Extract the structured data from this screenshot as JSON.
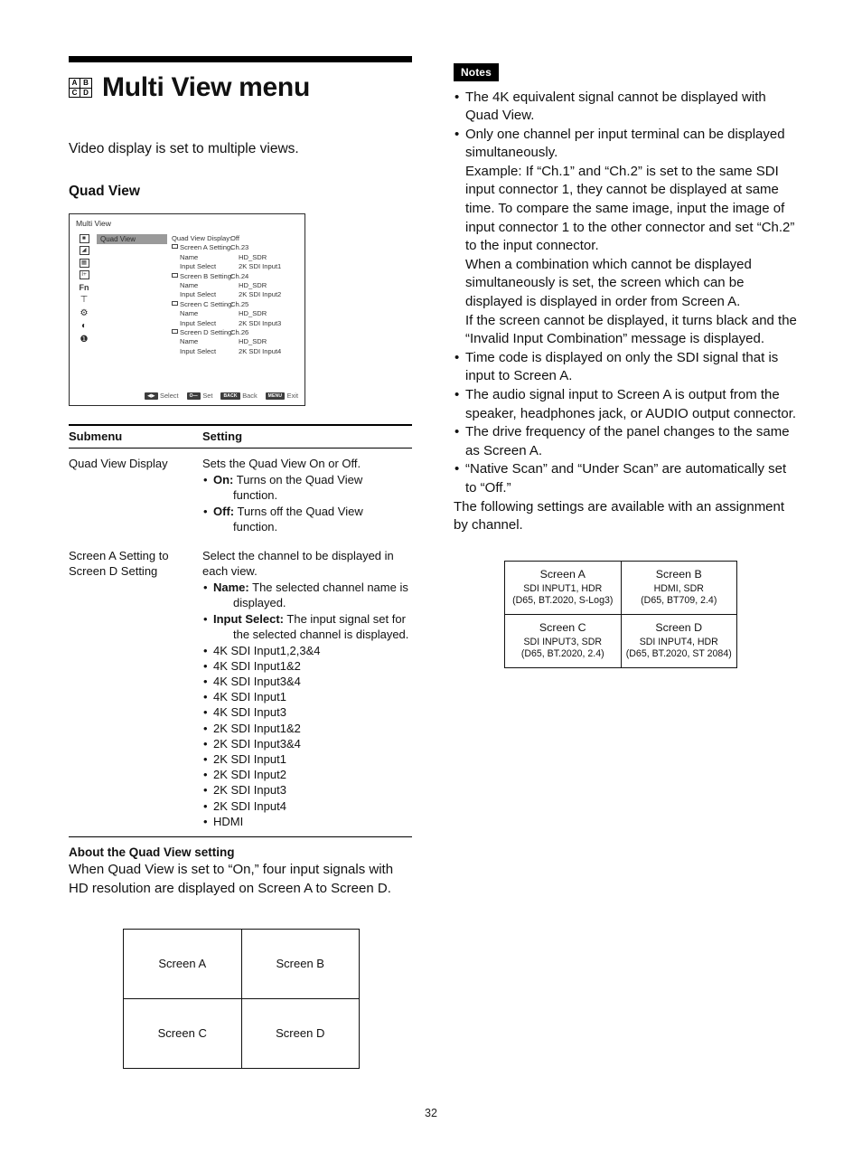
{
  "title": {
    "heading": "Multi View menu",
    "icon_cells": [
      "A",
      "B",
      "C",
      "D"
    ],
    "intro": "Video display is set to multiple views.",
    "section": "Quad View"
  },
  "osd": {
    "window_title": "Multi View",
    "sidebar_icons": [
      "1",
      "picture-icon",
      "grid-icon",
      "input-icon",
      "Fn",
      "layout-icon",
      "gear-icon",
      "contrast-icon",
      "info-icon"
    ],
    "selected_item": "Quad View",
    "rows": [
      {
        "label": "Quad View Display:",
        "value": "Off",
        "indent": false,
        "marker": false
      },
      {
        "label": "Screen A Setting:",
        "value": "Ch.23",
        "indent": false,
        "marker": true
      },
      {
        "label": "Name",
        "value": "HD_SDR",
        "indent": true,
        "marker": false
      },
      {
        "label": "Input Select",
        "value": "2K SDI Input1",
        "indent": true,
        "marker": false
      },
      {
        "label": "Screen B Setting:",
        "value": "Ch.24",
        "indent": false,
        "marker": true
      },
      {
        "label": "Name",
        "value": "HD_SDR",
        "indent": true,
        "marker": false
      },
      {
        "label": "Input Select",
        "value": "2K SDI Input2",
        "indent": true,
        "marker": false
      },
      {
        "label": "Screen C Setting:",
        "value": "Ch.25",
        "indent": false,
        "marker": true
      },
      {
        "label": "Name",
        "value": "HD_SDR",
        "indent": true,
        "marker": false
      },
      {
        "label": "Input Select",
        "value": "2K SDI Input3",
        "indent": true,
        "marker": false
      },
      {
        "label": "Screen D Setting:",
        "value": "Ch.26",
        "indent": false,
        "marker": true
      },
      {
        "label": "Name",
        "value": "HD_SDR",
        "indent": true,
        "marker": false
      },
      {
        "label": "Input Select",
        "value": "2K SDI Input4",
        "indent": true,
        "marker": false
      }
    ],
    "footer_keys": [
      {
        "key": "◀▶",
        "label": "Select"
      },
      {
        "key": "O—",
        "label": "Set"
      },
      {
        "key": "BACK",
        "label": "Back"
      },
      {
        "key": "MENU",
        "label": "Exit"
      }
    ]
  },
  "submenu_table": {
    "headers": {
      "col1": "Submenu",
      "col2": "Setting"
    },
    "rows": [
      {
        "submenu": "Quad View Display",
        "indent": false,
        "lead": "Sets the Quad View On or Off.",
        "bullets": [
          {
            "key": "On:",
            "text": " Turns on the Quad View",
            "hang": "function."
          },
          {
            "key": "Off:",
            "text": " Turns off the Quad View",
            "hang": "function."
          }
        ],
        "options": []
      },
      {
        "submenu": "Screen A Setting to Screen D Setting",
        "indent": true,
        "lead": "Select the channel to be displayed in each view.",
        "bullets": [
          {
            "key": "Name:",
            "text": " The selected channel name is",
            "hang": "displayed."
          },
          {
            "key": "Input Select:",
            "text": " The input signal set for",
            "hang": "the selected channel is displayed."
          }
        ],
        "options": [
          "4K SDI Input1,2,3&4",
          "4K SDI Input1&2",
          "4K SDI Input3&4",
          "4K SDI Input1",
          "4K SDI Input3",
          "2K SDI Input1&2",
          "2K SDI Input3&4",
          "2K SDI Input1",
          "2K SDI Input2",
          "2K SDI Input3",
          "2K SDI Input4",
          "HDMI"
        ]
      }
    ]
  },
  "about": {
    "heading": "About the Quad View setting",
    "body": "When Quad View is set to “On,” four input signals with HD resolution are displayed on Screen A to Screen D."
  },
  "screen_grid_simple": {
    "cells": [
      "Screen A",
      "Screen B",
      "Screen C",
      "Screen D"
    ]
  },
  "screen_grid_detail": {
    "cells": [
      {
        "name": "Screen A",
        "line1": "SDI INPUT1, HDR",
        "line2": "(D65, BT.2020, S-Log3)"
      },
      {
        "name": "Screen B",
        "line1": "HDMI, SDR",
        "line2": "(D65, BT709, 2.4)"
      },
      {
        "name": "Screen C",
        "line1": "SDI INPUT3, SDR",
        "line2": "(D65, BT.2020, 2.4)"
      },
      {
        "name": "Screen D",
        "line1": "SDI INPUT4, HDR",
        "line2": "(D65, BT.2020, ST 2084)"
      }
    ]
  },
  "notes": {
    "badge": "Notes",
    "items": [
      {
        "text": "The 4K equivalent signal cannot be displayed with Quad View.",
        "subs": []
      },
      {
        "text": "Only one channel per input terminal can be displayed simultaneously.",
        "subs": [
          "Example: If “Ch.1” and “Ch.2” is set to the same SDI input connector 1, they cannot be displayed at same time. To compare the same image, input the image of input connector 1 to the other connector and set “Ch.2” to the input connector.",
          "When a combination which cannot be displayed simultaneously is set, the screen which can be displayed is displayed in order from Screen A.",
          "If the screen cannot be displayed, it turns black and the “Invalid Input Combination” message is displayed."
        ]
      },
      {
        "text": "Time code is displayed on only the SDI signal that is input to Screen A.",
        "subs": []
      },
      {
        "text": "The audio signal input to Screen A is output from the speaker, headphones jack, or AUDIO output connector.",
        "subs": []
      },
      {
        "text": "The drive frequency of the panel changes to the same as Screen A.",
        "subs": []
      },
      {
        "text": "“Native Scan” and “Under Scan” are automatically set to “Off.”",
        "subs": []
      }
    ],
    "tail": "The following settings are available with an assignment by channel."
  },
  "footer": {
    "page_number": "32"
  }
}
